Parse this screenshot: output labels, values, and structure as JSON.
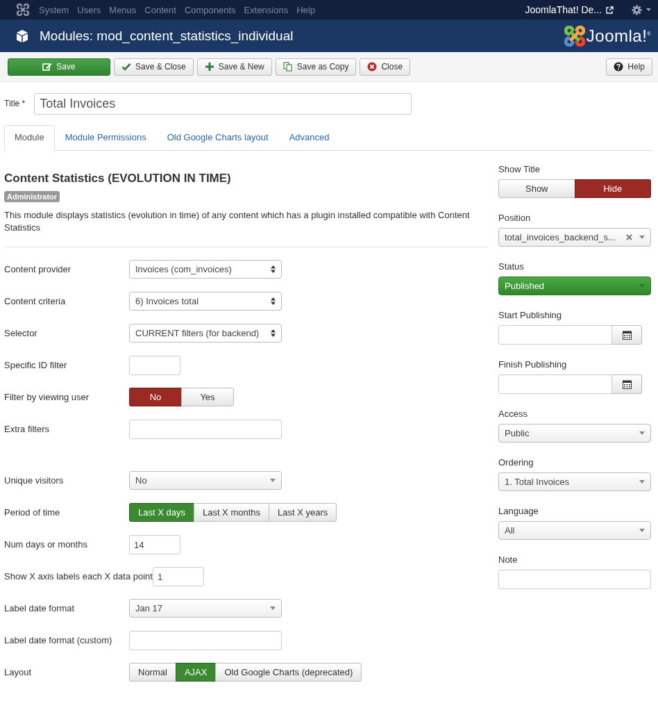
{
  "top_menu": {
    "items": [
      "System",
      "Users",
      "Menus",
      "Content",
      "Components",
      "Extensions",
      "Help"
    ],
    "site_link": "JoomlaThat! De..."
  },
  "header": {
    "title": "Modules: mod_content_statistics_individual",
    "logo_text": "Joomla!$^{®}$"
  },
  "toolbar": {
    "buttons": [
      {
        "label": "Save",
        "kind": "edit",
        "primary": true
      },
      {
        "label": "Save & Close",
        "kind": "check",
        "primary": false
      },
      {
        "label": "Save & New",
        "kind": "plus",
        "primary": false
      },
      {
        "label": "Save as Copy",
        "kind": "copy",
        "primary": false
      },
      {
        "label": "Close",
        "kind": "close",
        "primary": false
      }
    ],
    "help": {
      "label": "Help",
      "kind": "help"
    }
  },
  "title_field": {
    "label": "Title *",
    "value": "Total Invoices"
  },
  "tabs": [
    {
      "label": "Module",
      "selected": true
    },
    {
      "label": "Module Permissions",
      "selected": false
    },
    {
      "label": "Old Google Charts layout",
      "selected": false
    },
    {
      "label": "Advanced",
      "selected": false
    }
  ],
  "module": {
    "heading": "Content Statistics (EVOLUTION IN TIME)",
    "badge": "Administrator",
    "description": "This module displays statistics (evolution in time) of any content which has a plugin installed compatible with Content Statistics"
  },
  "fields": [
    {
      "label": "Content provider",
      "kind": "select",
      "value": "Invoices (com_invoices)"
    },
    {
      "label": "Content criteria",
      "kind": "select",
      "value": "6) Invoices total"
    },
    {
      "label": "Selector",
      "kind": "select",
      "value": "CURRENT filters (for backend)"
    },
    {
      "label": "Specific ID filter",
      "kind": "short-text"
    },
    {
      "label": "Filter by viewing user",
      "kind": "switch",
      "options": [
        {
          "label": "No",
          "selected": true
        },
        {
          "label": "Yes",
          "selected": false
        }
      ]
    },
    {
      "label": "Extra filters",
      "kind": "textarea"
    },
    {
      "label": "Unique visitors",
      "kind": "dropdown",
      "value": "No"
    },
    {
      "label": "Period of time",
      "kind": "toggle",
      "options": [
        {
          "label": "Last X days",
          "selected": true
        },
        {
          "label": "Last X months",
          "selected": false
        },
        {
          "label": "Last X years",
          "selected": false
        }
      ]
    },
    {
      "label": "Num days or months",
      "kind": "short-text",
      "value": "14"
    },
    {
      "label": "Show X axis labels each X data point",
      "kind": "short-text",
      "value": "1"
    },
    {
      "label": "Label date format",
      "kind": "dropdown",
      "value": "Jan 17"
    },
    {
      "label": "Label date format (custom)",
      "kind": "text"
    },
    {
      "label": "Layout",
      "kind": "toggle",
      "options": [
        {
          "label": "Normal",
          "selected": false
        },
        {
          "label": "AJAX",
          "selected": true
        },
        {
          "label": "Old Google Charts (deprecated)",
          "selected": false
        }
      ]
    }
  ],
  "sidebar": {
    "fields": [
      {
        "label": "Show Title",
        "kind": "switch",
        "options": [
          {
            "label": "Show",
            "selected": false
          },
          {
            "label": "Hide",
            "selected": true
          }
        ]
      },
      {
        "label": "Position",
        "kind": "clearable",
        "value": "total_invoices_backend_s..."
      },
      {
        "label": "Status",
        "kind": "status",
        "value": "Published"
      },
      {
        "label": "Start Publishing",
        "kind": "date"
      },
      {
        "label": "Finish Publishing",
        "kind": "date"
      },
      {
        "label": "Access",
        "kind": "dropdown",
        "value": "Public"
      },
      {
        "label": "Ordering",
        "kind": "dropdown",
        "value": "1. Total Invoices"
      },
      {
        "label": "Language",
        "kind": "dropdown",
        "value": "All"
      },
      {
        "label": "Note",
        "kind": "text"
      }
    ]
  }
}
